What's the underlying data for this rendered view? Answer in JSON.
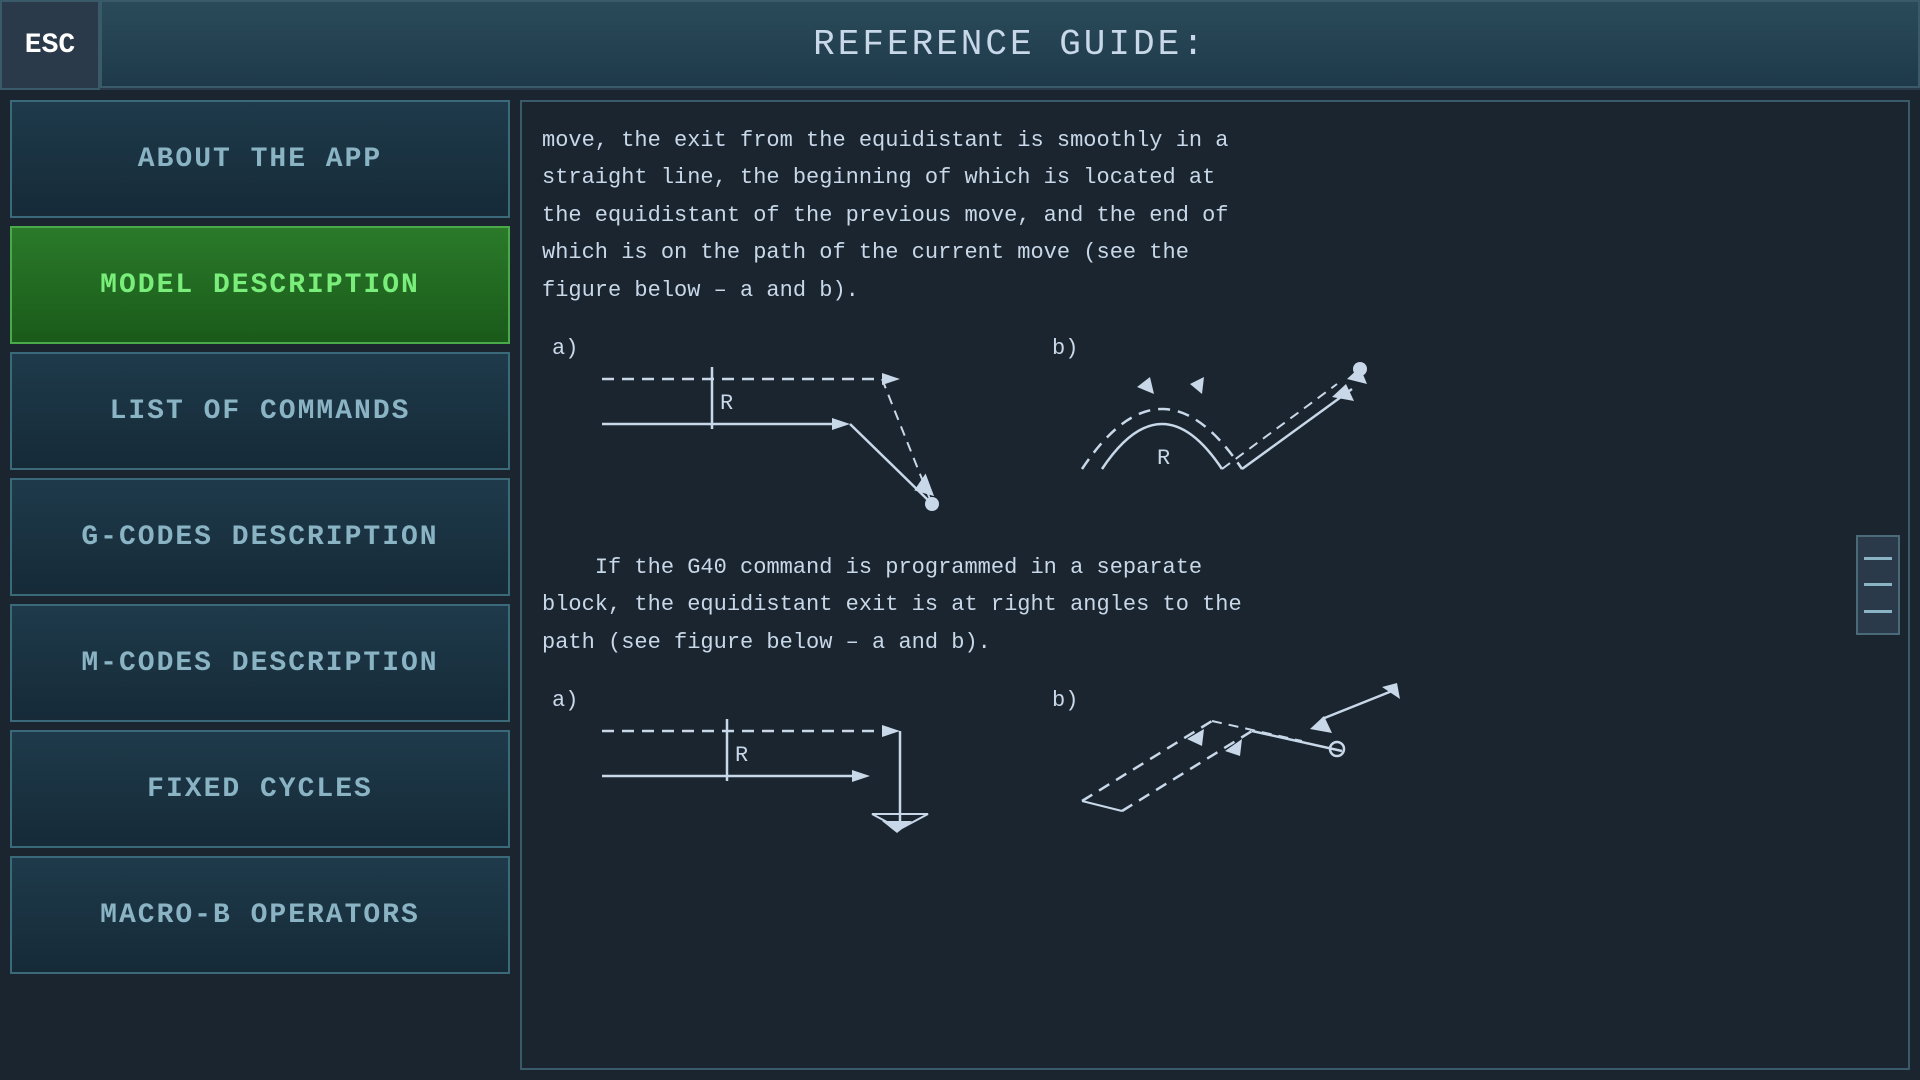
{
  "header": {
    "esc_label": "ESC",
    "title": "REFERENCE GUIDE:"
  },
  "sidebar": {
    "items": [
      {
        "id": "about",
        "label": "ABOUT THE APP",
        "active": false
      },
      {
        "id": "model",
        "label": "MODEL DESCRIPTION",
        "active": true
      },
      {
        "id": "commands",
        "label": "LIST OF COMMANDS",
        "active": false
      },
      {
        "id": "gcodes",
        "label": "G-CODES DESCRIPTION",
        "active": false
      },
      {
        "id": "mcodes",
        "label": "M-CODES DESCRIPTION",
        "active": false
      },
      {
        "id": "fixed",
        "label": "FIXED CYCLES",
        "active": false
      },
      {
        "id": "macro",
        "label": "MACRO-B OPERATORS",
        "active": false
      }
    ]
  },
  "content": {
    "paragraph1": "move, the exit from the equidistant is smoothly in a\nstraight line, the beginning of which is located at\nthe equidistant of the previous move, and the end of\nwhich is on the path of the current move (see the\nfigure below – a and b).",
    "paragraph2": "    If the G40 command is programmed in a separate\nblock, the equidistant exit is at right angles to the\npath (see figure below – a and b)."
  },
  "colors": {
    "background": "#1a2530",
    "sidebar_bg": "#1e3a4a",
    "active_bg": "#2a7a2a",
    "text_main": "#c8d8e8",
    "text_active": "#7aee7a",
    "border": "#3a6a7a",
    "diagram_stroke": "#ffffff"
  }
}
